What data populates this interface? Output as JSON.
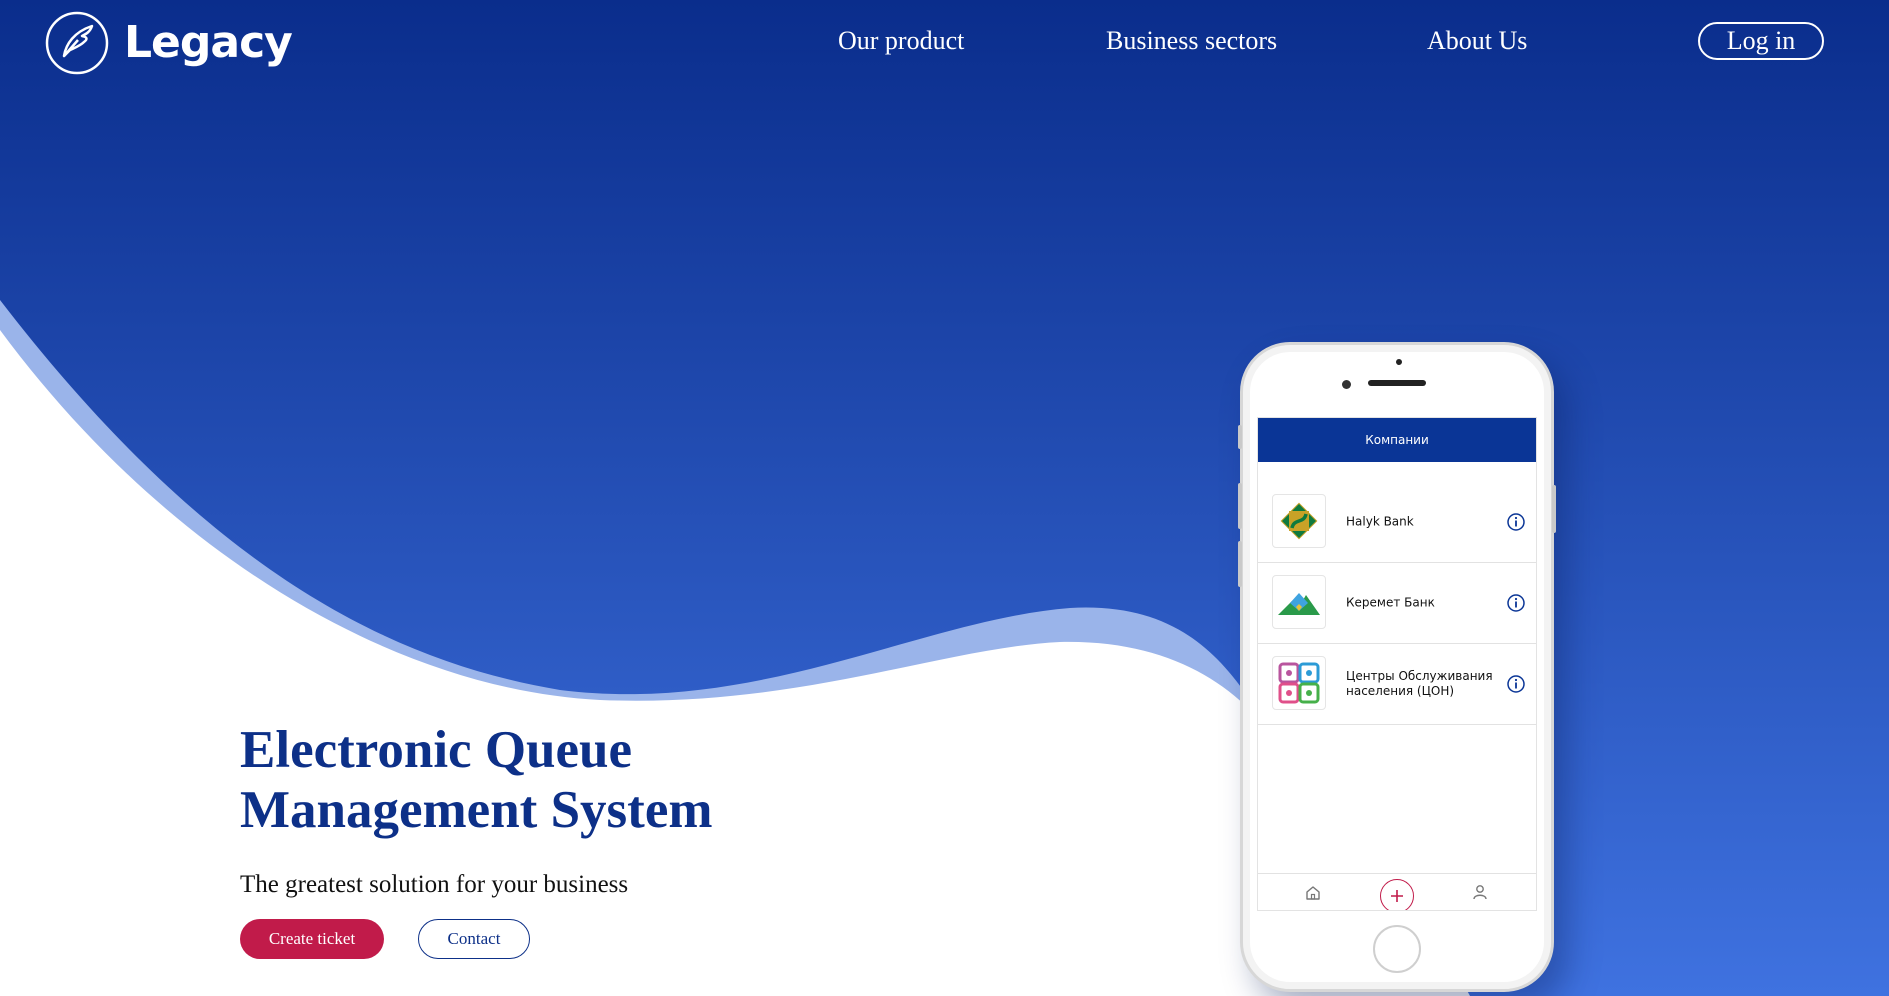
{
  "brand": {
    "name": "Legacy",
    "logo_icon": "feather-wing-logo"
  },
  "nav": {
    "items": [
      {
        "label": "Our product"
      },
      {
        "label": "Business sectors"
      },
      {
        "label": "About Us"
      }
    ],
    "login_label": "Log in"
  },
  "hero": {
    "title_line1": "Electronic Queue",
    "title_line2": "Management System",
    "subtitle": "The greatest solution for your business",
    "primary_button": "Create ticket",
    "secondary_button": "Contact"
  },
  "phone": {
    "header_title": "Компании",
    "companies": [
      {
        "name": "Halyk Bank",
        "logo": "halyk-bank-logo",
        "info_icon": "info-icon"
      },
      {
        "name": "Керемет Банк",
        "logo": "keremet-bank-logo",
        "info_icon": "info-icon"
      },
      {
        "name": "Центры Обслуживания населения (ЦОН)",
        "logo": "con-logo",
        "info_icon": "info-icon"
      }
    ],
    "tabbar": {
      "left_icon": "home-icon",
      "center_icon": "plus-icon",
      "right_icon": "profile-icon"
    }
  },
  "colors": {
    "brand_blue": "#0d3088",
    "accent_red": "#c11b4a",
    "gradient_top": "#0a2d8c",
    "gradient_bottom": "#3f72e0",
    "wave_light": "#9ab4ea"
  }
}
